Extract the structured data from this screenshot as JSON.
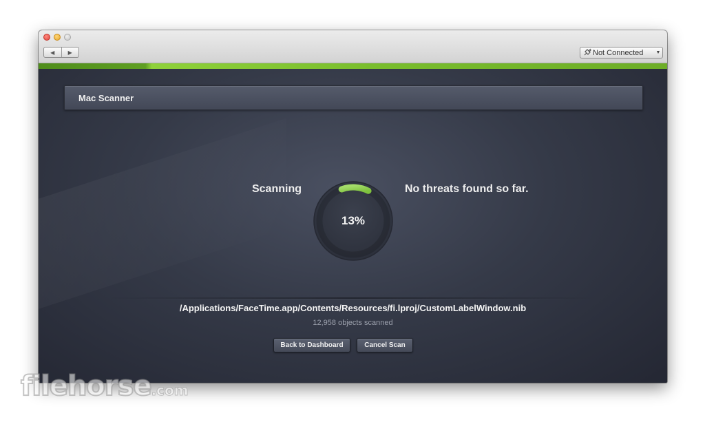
{
  "toolbar": {
    "back_icon": "back-arrow-icon",
    "forward_icon": "forward-arrow-icon",
    "connection": {
      "icon": "plug-icon",
      "label": "Not Connected"
    }
  },
  "colors": {
    "accent_green": "#8fd13a",
    "background": "#353a48"
  },
  "panel": {
    "title": "Mac Scanner"
  },
  "scan": {
    "status_label": "Scanning",
    "progress_percent": 13,
    "progress_text": "13%",
    "result_text": "No threats found so far.",
    "current_path": "/Applications/FaceTime.app/Contents/Resources/fi.lproj/CustomLabelWindow.nib",
    "objects_scanned": "12,958 objects scanned"
  },
  "buttons": {
    "back_label": "Back to Dashboard",
    "cancel_label": "Cancel Scan"
  },
  "watermark": {
    "main": "filehorse",
    "suffix": ".com"
  }
}
